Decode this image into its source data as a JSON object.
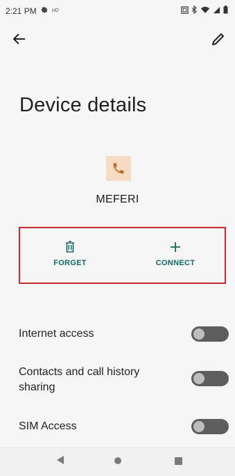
{
  "status_bar": {
    "time": "2:21 PM",
    "hd_label": "HD",
    "icons": [
      "gear-icon",
      "nfc-icon",
      "bluetooth-icon",
      "wifi-icon",
      "signal-icon",
      "battery-icon"
    ]
  },
  "app_bar": {
    "back_icon": "back-arrow-icon",
    "edit_icon": "pencil-icon"
  },
  "page": {
    "title": "Device details",
    "device_name": "MEFERI",
    "device_icon": "phone-icon",
    "accent_color": "#0b6b66",
    "device_icon_bg": "#f7dcc4",
    "device_icon_color": "#c26b1b"
  },
  "actions": {
    "forget_label": "FORGET",
    "connect_label": "CONNECT",
    "highlight_color": "#e0222c"
  },
  "settings": [
    {
      "label": "Internet access",
      "enabled": false
    },
    {
      "label": "Contacts and call history sharing",
      "enabled": false
    },
    {
      "label": "SIM Access",
      "enabled": false
    }
  ],
  "nav_bar": {
    "icons": [
      "nav-back-icon",
      "nav-home-icon",
      "nav-recents-icon"
    ]
  }
}
